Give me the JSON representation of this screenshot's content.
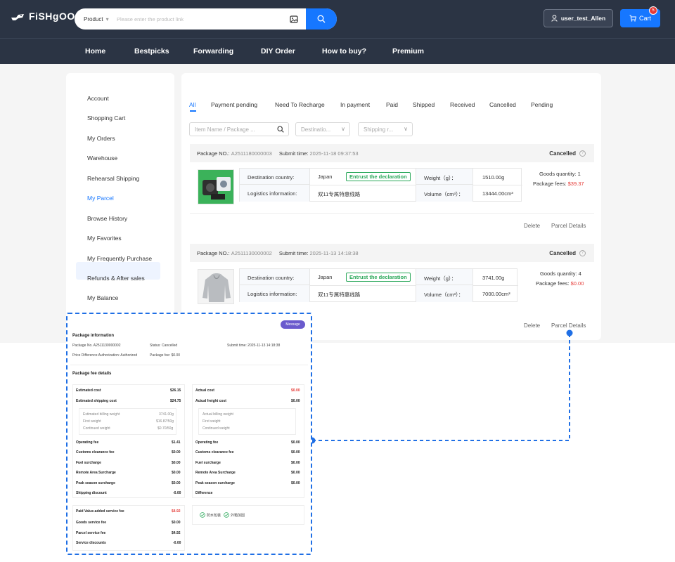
{
  "header": {
    "logo_text": "FiSHgOO",
    "search": {
      "type_label": "Product",
      "placeholder": "Please enter the product link"
    },
    "user_label": "user_test_Allen",
    "cart_label": "Cart",
    "cart_count": "5"
  },
  "nav": [
    "Home",
    "Bestpicks",
    "Forwarding",
    "DIY Order",
    "How to buy?",
    "Premium"
  ],
  "sidebar": [
    "Account",
    "Shopping Cart",
    "My Orders",
    "Warehouse",
    "Rehearsal Shipping",
    "My Parcel",
    "Browse History",
    "My Favorites",
    "My Frequently Purchase",
    "Refunds & After sales",
    "My Balance"
  ],
  "tabs": [
    "All",
    "Payment pending",
    "Need To Recharge",
    "In payment",
    "Paid",
    "Shipped",
    "Received",
    "Cancelled",
    "Pending"
  ],
  "filters": {
    "search_placeholder": "Item Name / Package ...",
    "destination": "Destinatio...",
    "shipping": "Shipping r..."
  },
  "parcels": [
    {
      "package_label": "Package NO.:",
      "package_no": "A2511180000003",
      "submit_label": "Submit time:",
      "submit_time": "2025-11-18 09:37:53",
      "status": "Cancelled",
      "dest_label": "Destination country:",
      "dest": "Japan",
      "tag": "Entrust the declaration",
      "logistics_label": "Logistics information:",
      "logistics": "双11专属特惠线路",
      "weight_label": "Weight（g）：",
      "weight": "1510.00g",
      "volume_label": "Volume（cm³）：",
      "volume": "13444.00cm³",
      "goods_qty": "Goods quantity: 1",
      "fees_label": "Package fees:",
      "fees": "$39.37",
      "delete": "Delete",
      "details": "Parcel Details"
    },
    {
      "package_label": "Package NO.:",
      "package_no": "A2511130000002",
      "submit_label": "Submit time:",
      "submit_time": "2025-11-13 14:18:38",
      "status": "Cancelled",
      "dest_label": "Destination country:",
      "dest": "Japan",
      "tag": "Entrust the declaration",
      "logistics_label": "Logistics information:",
      "logistics": "双11专属特惠线路",
      "weight_label": "Weight（g）：",
      "weight": "3741.00g",
      "volume_label": "Volume（cm³）：",
      "volume": "7000.00cm³",
      "goods_qty": "Goods quantity: 4",
      "fees_label": "Package fees:",
      "fees": "$0.00",
      "delete": "Delete",
      "details": "Parcel Details"
    }
  ],
  "detail": {
    "message_btn": "Message",
    "info_title": "Package information",
    "pkg_no": "Package No. A2511130000002",
    "status": "Status: Cancelled",
    "submit": "Submit time: 2025-11-13 14:18:38",
    "price_diff_label": "Price Difference Authorization:",
    "price_diff": "Authorized",
    "pkg_fee": "Package fee: $0.00",
    "fee_title": "Package fee details",
    "left": {
      "est_cost_label": "Estimated cost",
      "est_cost": "$26.15",
      "est_ship_label": "Estimated shipping cost",
      "est_ship": "$24.75",
      "billing_label": "Estimated billing weight",
      "billing": "3741.00g",
      "first_label": "First weight",
      "first": "$16.87/50g",
      "cont_label": "Continued weight",
      "cont": "$0.70/50g",
      "rows": [
        {
          "label": "Operating fee",
          "value": "$1.41"
        },
        {
          "label": "Customs clearance fee",
          "value": "$0.00"
        },
        {
          "label": "Fuel surcharge",
          "value": "$0.00"
        },
        {
          "label": "Remote Area Surcharge",
          "value": "$0.00"
        },
        {
          "label": "Peak season surcharge",
          "value": "$0.00"
        },
        {
          "label": "Shipping discount",
          "value": "-0.00"
        }
      ],
      "vas_label": "Paid Value-added service fee",
      "vas": "$4.92",
      "vas_rows": [
        {
          "label": "Goods service fee",
          "value": "$0.00"
        },
        {
          "label": "Parcel service fee",
          "value": "$4.92"
        },
        {
          "label": "Service discounts",
          "value": "-0.00"
        }
      ]
    },
    "right": {
      "act_cost_label": "Actual cost",
      "act_cost": "$0.00",
      "act_freight_label": "Actual freight cost",
      "act_freight": "$0.00",
      "billing_label": "Actual billing weight",
      "first_label": "First weight",
      "cont_label": "Continued weight",
      "rows": [
        {
          "label": "Operating fee",
          "value": "$0.00"
        },
        {
          "label": "Customs clearance fee",
          "value": "$0.00"
        },
        {
          "label": "Fuel surcharge",
          "value": "$0.00"
        },
        {
          "label": "Remote Area Surcharge",
          "value": "$0.00"
        },
        {
          "label": "Peak season surcharge",
          "value": "$0.00"
        },
        {
          "label": "Difference",
          "value": ""
        }
      ],
      "services": [
        "防水包装",
        "外箱加固"
      ]
    }
  },
  "colors": {
    "primary": "#1677ff",
    "header_bg": "#2b3444",
    "price_red": "#e53935",
    "tag_green": "#2aa85a",
    "callout_blue": "#1f6fe5"
  }
}
